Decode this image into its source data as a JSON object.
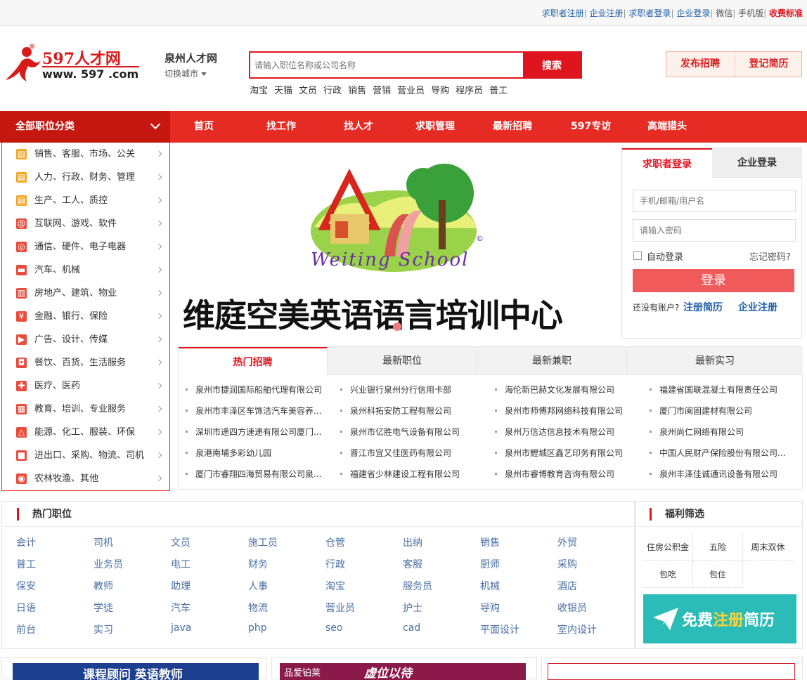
{
  "topbar": {
    "links": [
      "求职者注册",
      "企业注册",
      "求职者登录",
      "企业登录",
      "微信",
      "手机版",
      "收费标准"
    ]
  },
  "logo": {
    "main": "597人才网",
    "url": "www. 597 .com",
    "reg": "®"
  },
  "city": {
    "name": "泉州人才网",
    "switch": "切换城市"
  },
  "search": {
    "placeholder": "请输入职位名称或公司名称",
    "button": "搜索"
  },
  "hot_keywords": [
    "淘宝",
    "天猫",
    "文员",
    "行政",
    "销售",
    "营销",
    "营业员",
    "导购",
    "程序员",
    "普工"
  ],
  "header_buttons": {
    "post_job": "发布招聘",
    "register_resume": "登记简历"
  },
  "nav": {
    "all_categories": "全部职位分类",
    "items": [
      "首页",
      "找工作",
      "找人才",
      "求职管理",
      "最新招聘",
      "597专访",
      "高端猎头"
    ]
  },
  "categories": [
    {
      "label": "销售、客服、市场、公关",
      "icon": "document-icon",
      "color": "#f5a623"
    },
    {
      "label": "人力、行政、财务、管理",
      "icon": "document-icon",
      "color": "#f5a623"
    },
    {
      "label": "生产、工人、质控",
      "icon": "document-icon",
      "color": "#f5a623"
    },
    {
      "label": "互联网、游戏、软件",
      "icon": "at-icon",
      "color": "#e84c3d"
    },
    {
      "label": "通信、硬件、电子电器",
      "icon": "antenna-icon",
      "color": "#e84c3d"
    },
    {
      "label": "汽车、机械",
      "icon": "car-icon",
      "color": "#e84c3d"
    },
    {
      "label": "房地产、建筑、物业",
      "icon": "building-icon",
      "color": "#e84c3d"
    },
    {
      "label": "金融、银行、保险",
      "icon": "yen-icon",
      "color": "#e84c3d"
    },
    {
      "label": "广告、设计、传媒",
      "icon": "video-icon",
      "color": "#e84c3d"
    },
    {
      "label": "餐饮、百货、生活服务",
      "icon": "bag-icon",
      "color": "#e84c3d"
    },
    {
      "label": "医疗、医药",
      "icon": "medical-icon",
      "color": "#e84c3d"
    },
    {
      "label": "教育、培训、专业服务",
      "icon": "book-icon",
      "color": "#e84c3d"
    },
    {
      "label": "能源、化工、服装、环保",
      "icon": "flask-icon",
      "color": "#e84c3d"
    },
    {
      "label": "进出口、采购、物流、司机",
      "icon": "truck-icon",
      "color": "#e84c3d"
    },
    {
      "label": "农林牧渔、其他",
      "icon": "globe-icon",
      "color": "#e84c3d"
    }
  ],
  "banner": {
    "school": "Weiting School",
    "headline": "维庭空美英语语言培训中心",
    "logo_letter": "A",
    "copyright": "©"
  },
  "login": {
    "tab_seeker": "求职者登录",
    "tab_company": "企业登录",
    "username_placeholder": "手机/邮箱/用户名",
    "password_placeholder": "请输入密码",
    "auto_login": "自动登录",
    "forgot": "忘记密码?",
    "submit": "登录",
    "no_account": "还没有账户?",
    "register_resume": "注册简历",
    "register_company": "企业注册"
  },
  "job_tabs": {
    "tabs": [
      "热门招聘",
      "最新职位",
      "最新兼职",
      "最新实习"
    ],
    "columns": [
      [
        "泉州市捷润国际船舶代理有限公司",
        "泉州市丰泽区车饰洁汽车美容养...",
        "深圳市递四方速递有限公司厦门...",
        "泉港南埔多彩幼儿园",
        "厦门市睿翔四海贸易有限公司泉..."
      ],
      [
        "兴业银行泉州分行信用卡部",
        "泉州科拓安防工程有限公司",
        "泉州市亿胜电气设备有限公司",
        "晋江市宜又佳医药有限公司",
        "福建省少林建设工程有限公司"
      ],
      [
        "海伦新巴赫文化发展有限公司",
        "泉州市师傅邦网络科技有限公司",
        "泉州万信达信息技术有限公司",
        "泉州市鲤城区鑫艺印务有限公司",
        "泉州市睿博教育咨询有限公司"
      ],
      [
        "福建省国联混凝土有限责任公司",
        "厦门市闽固建材有限公司",
        "泉州尚仁网络有限公司",
        "中国人民财产保险股份有限公司...",
        "泉州丰泽佳诚通讯设备有限公司"
      ]
    ]
  },
  "hot_positions": {
    "title": "热门职位",
    "rows": [
      [
        "会计",
        "司机",
        "文员",
        "施工员",
        "仓管",
        "出纳",
        "销售",
        "外贸"
      ],
      [
        "普工",
        "业务员",
        "电工",
        "财务",
        "行政",
        "客服",
        "厨师",
        "采购"
      ],
      [
        "保安",
        "教师",
        "助理",
        "人事",
        "淘宝",
        "服务员",
        "机械",
        "酒店"
      ],
      [
        "日语",
        "学徒",
        "汽车",
        "物流",
        "营业员",
        "护士",
        "导购",
        "收银员"
      ],
      [
        "前台",
        "实习",
        "java",
        "php",
        "seo",
        "cad",
        "平面设计",
        "室内设计"
      ]
    ]
  },
  "welfare": {
    "title": "福利筛选",
    "items": [
      "住房公积金",
      "五险",
      "周末双休",
      "包吃",
      "包住"
    ],
    "register_banner": {
      "prefix": "免费",
      "highlight": "注册",
      "suffix": "简历"
    }
  },
  "ads": [
    "课程顾问 英语教师",
    "品爱铂莱",
    "虚位以待"
  ],
  "colors": {
    "brand_red": "#e0141e",
    "nav_red": "#e62b24",
    "dark_red": "#c5170f",
    "link_blue": "#1f5fa8",
    "teal": "#2bbcb7"
  }
}
